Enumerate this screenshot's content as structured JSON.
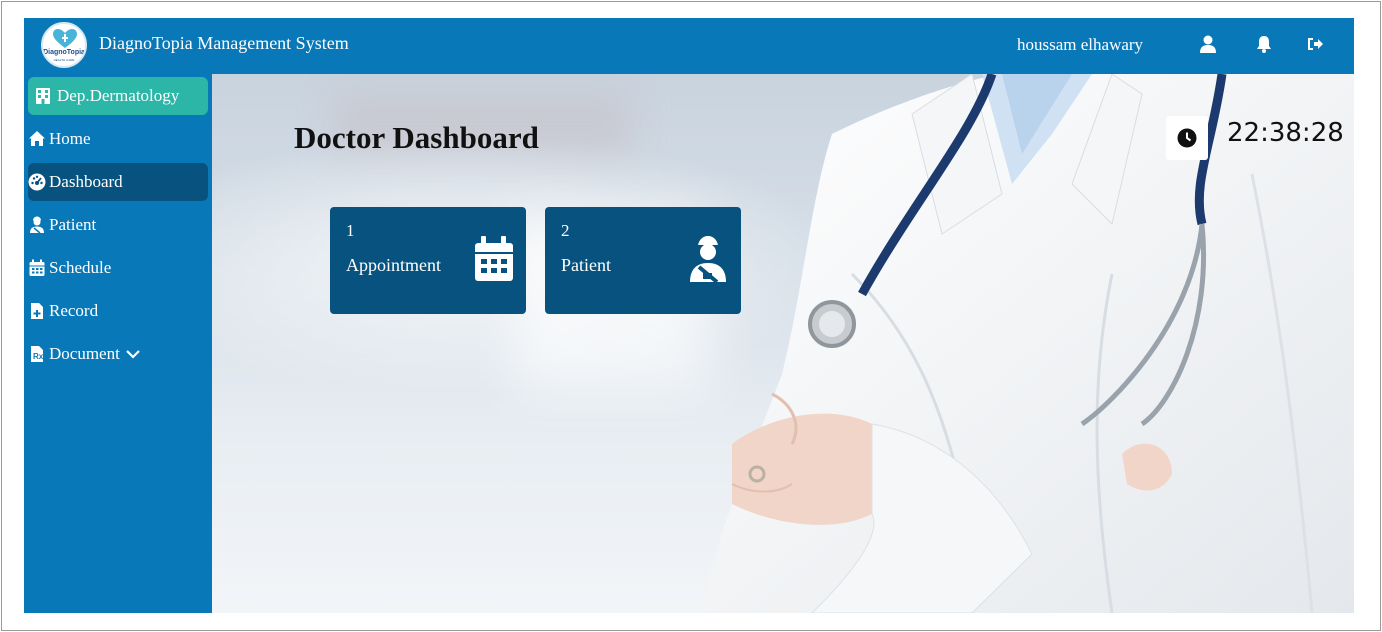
{
  "logo": {
    "text": "DiagnoTopia",
    "subtext": "HEALTH CARE"
  },
  "header": {
    "title": "DiagnoTopia Management System",
    "username": "houssam elhawary",
    "icons": [
      "user-icon",
      "bell-icon",
      "logout-icon"
    ]
  },
  "sidebar": {
    "department": "Dep.Dermatology",
    "items": [
      {
        "label": "Home",
        "icon": "home-icon"
      },
      {
        "label": "Dashboard",
        "icon": "dashboard-icon"
      },
      {
        "label": "Patient",
        "icon": "patient-icon"
      },
      {
        "label": "Schedule",
        "icon": "calendar-icon"
      },
      {
        "label": "Record",
        "icon": "record-file-icon"
      },
      {
        "label": "Document",
        "icon": "prescription-file-icon"
      }
    ],
    "active_item": "Dashboard"
  },
  "main": {
    "title": "Doctor Dashboard",
    "clock": "22:38:28",
    "cards": [
      {
        "count": "1",
        "label": "Appointment",
        "icon": "calendar-icon"
      },
      {
        "count": "2",
        "label": "Patient",
        "icon": "patient-icon"
      }
    ]
  },
  "colors": {
    "primary": "#0978b8",
    "dark_primary": "#07527f",
    "accent": "#2bb6a7"
  }
}
